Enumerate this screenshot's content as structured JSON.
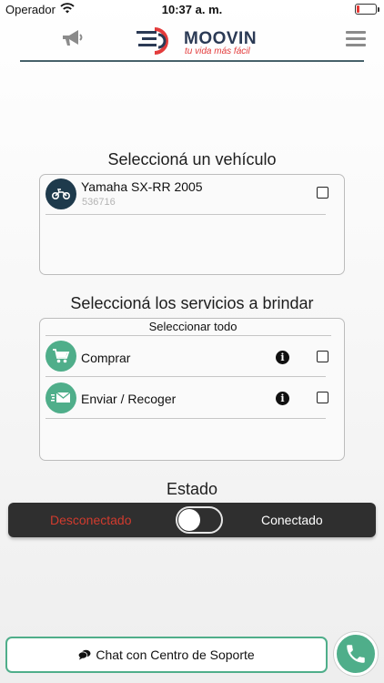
{
  "status_bar": {
    "carrier": "Operador",
    "time": "10:37 a. m."
  },
  "header": {
    "brand": "MOOVIN",
    "tagline": "tu vida más fácil"
  },
  "vehicle_section": {
    "title": "Seleccioná un vehículo",
    "vehicles": [
      {
        "name": "Yamaha SX-RR 2005",
        "plate": "536716",
        "checked": false
      }
    ]
  },
  "services_section": {
    "title": "Seleccioná los servicios a brindar",
    "select_all": "Seleccionar todo",
    "services": [
      {
        "label": "Comprar",
        "icon": "cart-icon",
        "checked": false
      },
      {
        "label": "Enviar / Recoger",
        "icon": "envelope-icon",
        "checked": false
      }
    ]
  },
  "estado": {
    "title": "Estado",
    "off_label": "Desconectado",
    "on_label": "Conectado",
    "connected": false
  },
  "footer": {
    "chat_label": "Chat con Centro de Soporte"
  },
  "colors": {
    "accent_green": "#4fae8a",
    "dark_navy": "#1e3a4c",
    "disconnected_red": "#d13b2e",
    "brand_red": "#e33b3b"
  }
}
